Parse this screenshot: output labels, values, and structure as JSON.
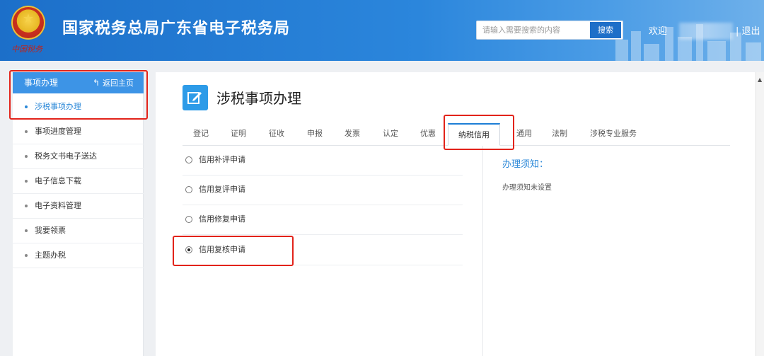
{
  "header": {
    "emblem_text": "中国税务",
    "site_title": "国家税务总局广东省电子税务局",
    "search_placeholder": "请输入需要搜索的内容",
    "search_button": "搜索",
    "welcome": "欢迎",
    "logout": "| 退出"
  },
  "sidebar": {
    "title": "事项办理",
    "back_label": "返回主页",
    "items": [
      {
        "label": "涉税事项办理",
        "active": true
      },
      {
        "label": "事项进度管理"
      },
      {
        "label": "税务文书电子送达"
      },
      {
        "label": "电子信息下载"
      },
      {
        "label": "电子资料管理"
      },
      {
        "label": "我要领票"
      },
      {
        "label": "主题办税"
      }
    ]
  },
  "main": {
    "page_title": "涉税事项办理",
    "tabs": [
      {
        "label": "登记"
      },
      {
        "label": "证明"
      },
      {
        "label": "征收"
      },
      {
        "label": "申报"
      },
      {
        "label": "发票"
      },
      {
        "label": "认定"
      },
      {
        "label": "优惠"
      },
      {
        "label": "纳税信用",
        "active": true
      },
      {
        "label": "通用"
      },
      {
        "label": "法制"
      },
      {
        "label": "涉税专业服务"
      }
    ],
    "options": [
      {
        "label": "信用补评申请",
        "checked": false
      },
      {
        "label": "信用复评申请",
        "checked": false
      },
      {
        "label": "信用修复申请",
        "checked": false
      },
      {
        "label": "信用复核申请",
        "checked": true
      }
    ],
    "notice": {
      "title": "办理须知：",
      "text": "办理须知未设置"
    }
  },
  "colors": {
    "header_blue": "#2b86dc",
    "sidebar_head": "#3d94e6",
    "accent": "#2b88d8",
    "highlight_red": "#e2231a"
  }
}
